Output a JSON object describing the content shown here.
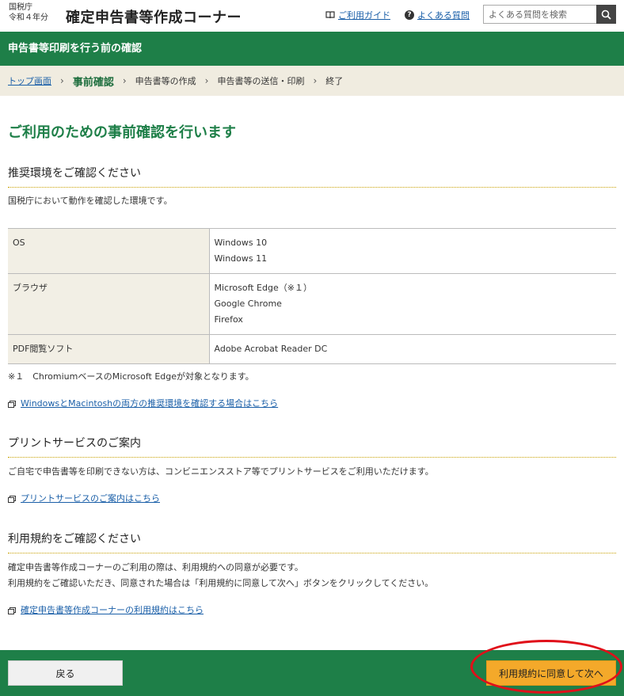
{
  "header": {
    "agency_line1": "国税庁",
    "agency_line2": "令和４年分",
    "site_title": "確定申告書等作成コーナー",
    "guide_link": "ご利用ガイド",
    "faq_link": "よくある質問",
    "search_placeholder": "よくある質問を検索"
  },
  "page_banner": "申告書等印刷を行う前の確認",
  "breadcrumb": {
    "items": [
      "トップ画面",
      "事前確認",
      "申告書等の作成",
      "申告書等の送信・印刷",
      "終了"
    ],
    "sep": "›"
  },
  "main": {
    "heading": "ご利用のための事前確認を行います",
    "env_section": {
      "title": "推奨環境をご確認ください",
      "intro": "国税庁において動作を確認した環境です。",
      "rows": [
        {
          "key": "OS",
          "values": [
            "Windows 10",
            "Windows 11"
          ]
        },
        {
          "key": "ブラウザ",
          "values": [
            "Microsoft Edge（※１）",
            "Google Chrome",
            "Firefox"
          ]
        },
        {
          "key": "PDF閲覧ソフト",
          "values": [
            "Adobe Acrobat Reader DC"
          ]
        }
      ],
      "note": "※１　ChromiumベースのMicrosoft Edgeが対象となります。",
      "link": "WindowsとMacintoshの両方の推奨環境を確認する場合はこちら"
    },
    "print_section": {
      "title": "プリントサービスのご案内",
      "text": "ご自宅で申告書等を印刷できない方は、コンビニエンスストア等でプリントサービスをご利用いただけます。",
      "link": "プリントサービスのご案内はこちら"
    },
    "terms_section": {
      "title": "利用規約をご確認ください",
      "text1": "確定申告書等作成コーナーのご利用の際は、利用規約への同意が必要です。",
      "text2": "利用規約をご確認いただき、同意された場合は「利用規約に同意して次へ」ボタンをクリックしてください。",
      "link": "確定申告書等作成コーナーの利用規約はこちら"
    }
  },
  "footer": {
    "back_label": "戻る",
    "next_label": "利用規約に同意して次へ"
  },
  "colors": {
    "brand_green": "#1e7f48",
    "next_button": "#f4a92a",
    "highlight": "#e0101a"
  }
}
